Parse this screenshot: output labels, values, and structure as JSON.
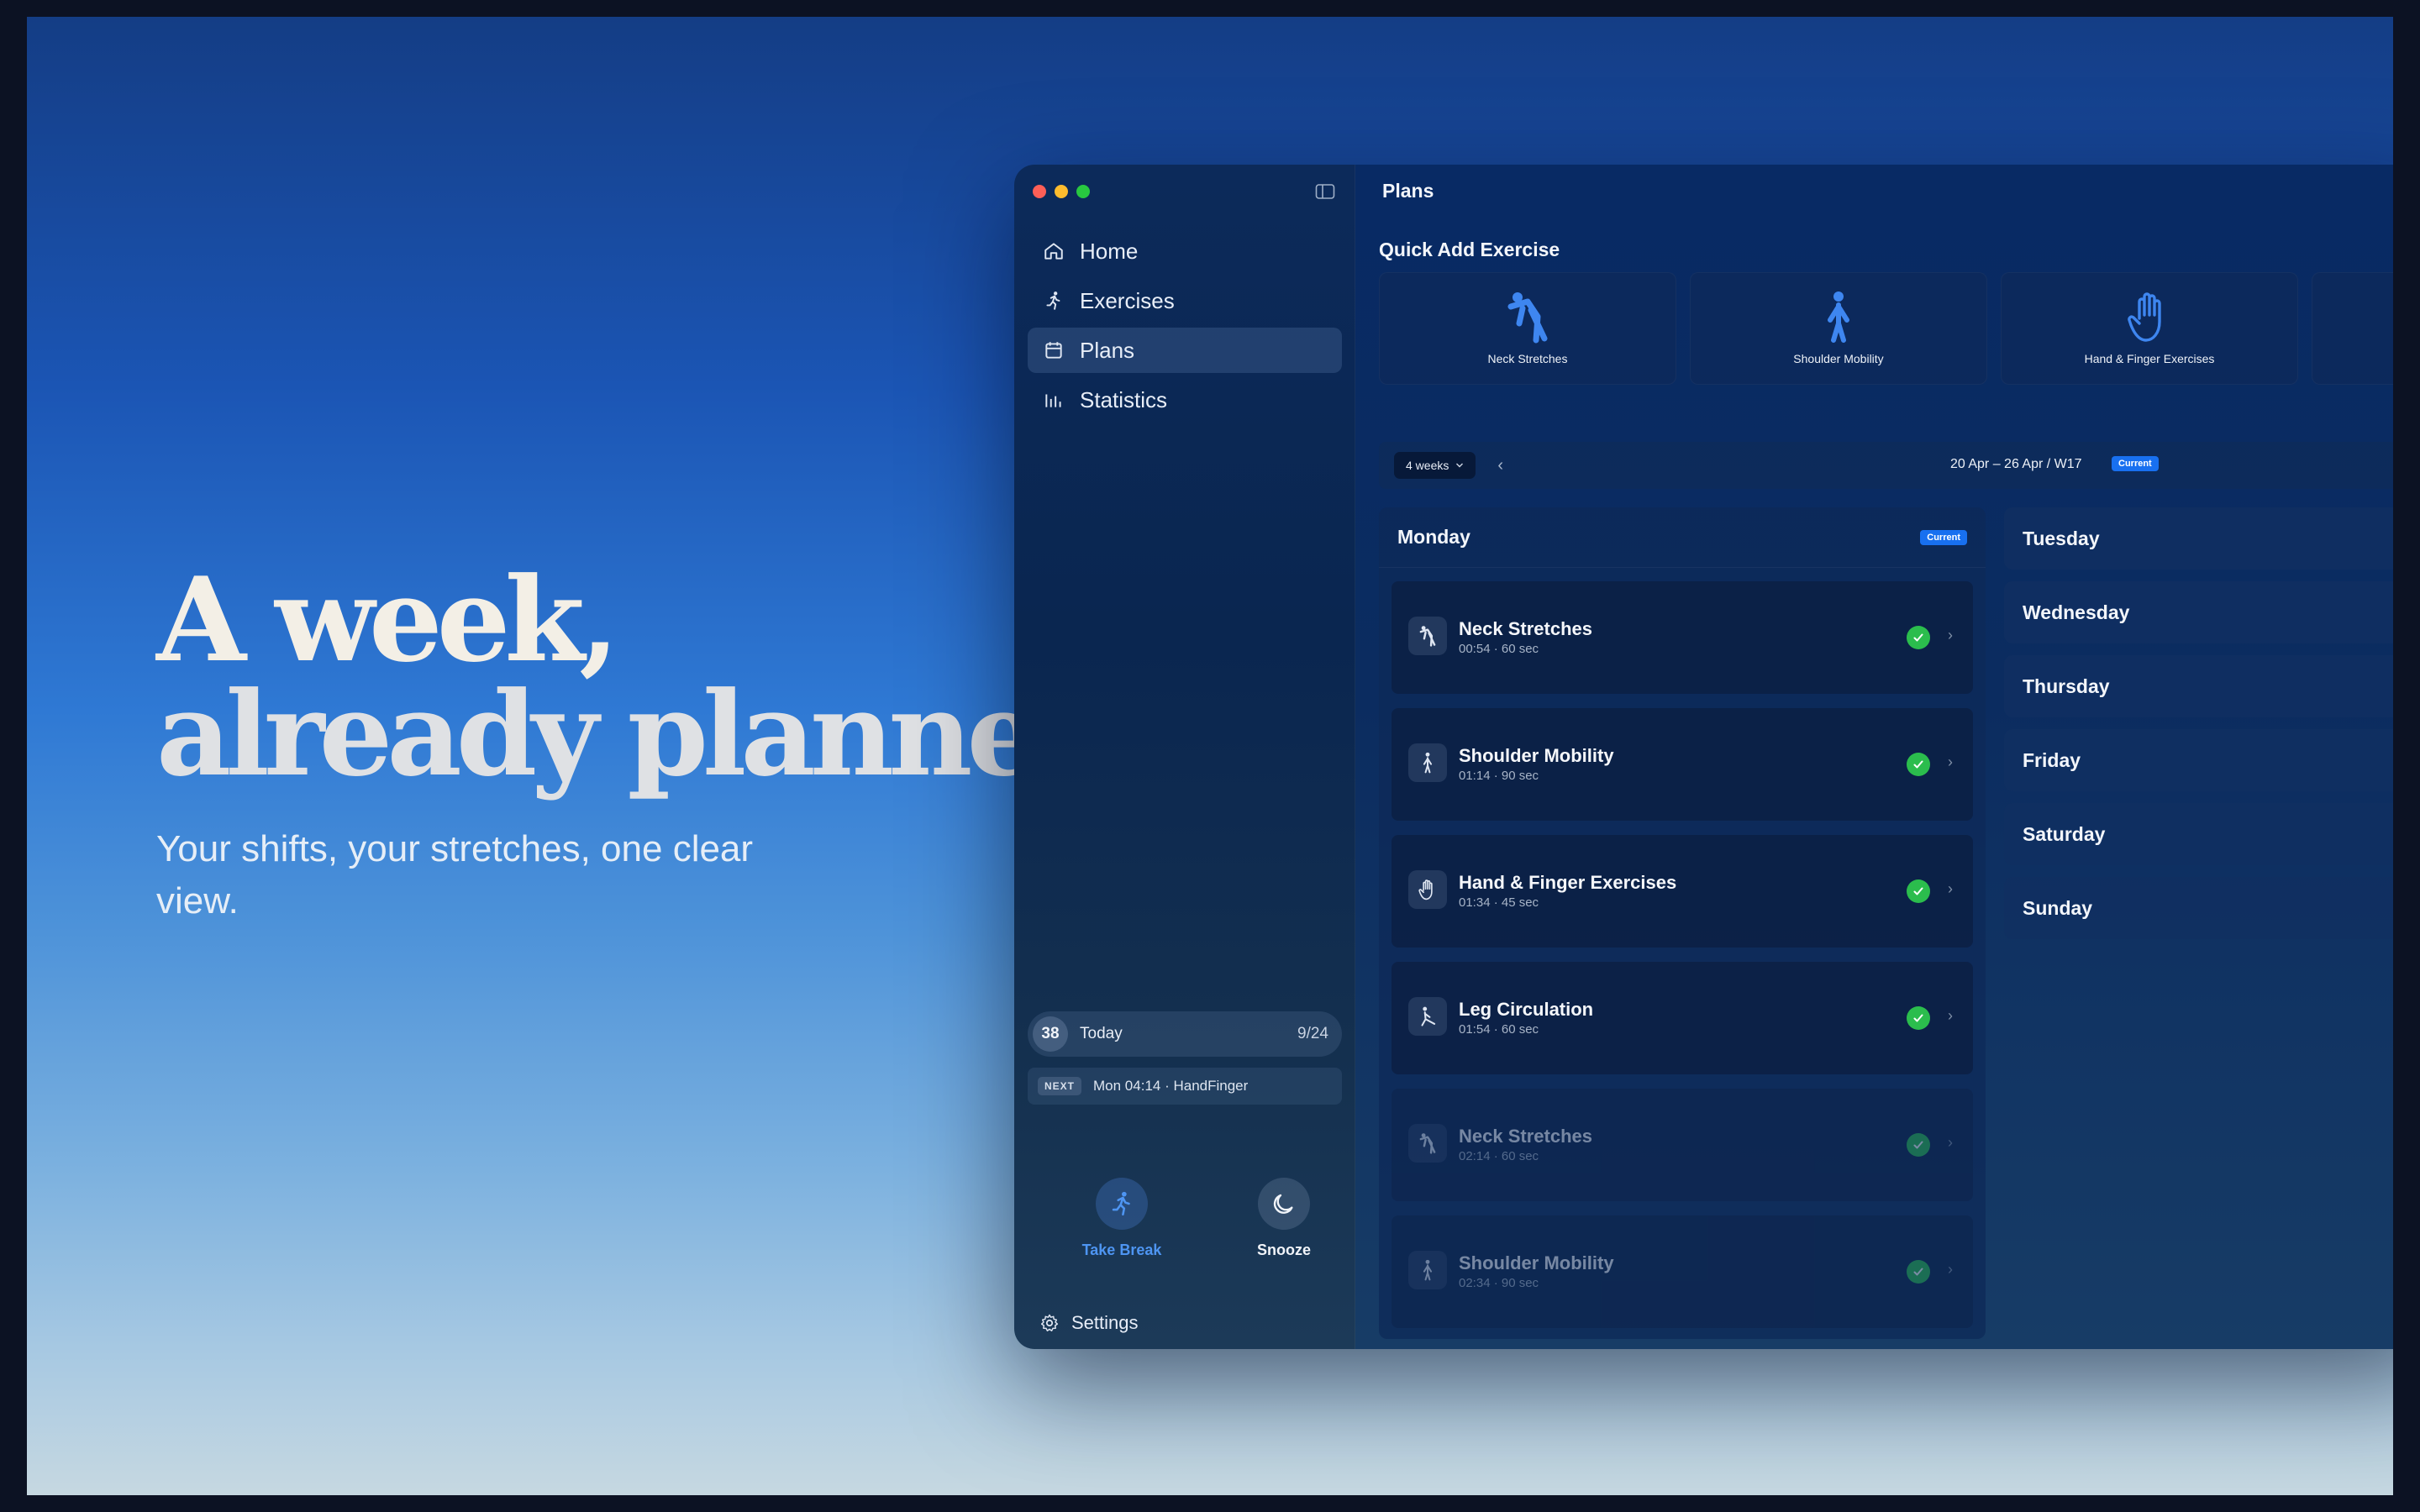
{
  "hero": {
    "title_line1": "A week,",
    "title_line2": "already planned.",
    "subtitle": "Your shifts, your stretches, one clear view."
  },
  "sidebar": {
    "nav": [
      {
        "label": "Home",
        "icon": "home-icon",
        "active": false
      },
      {
        "label": "Exercises",
        "icon": "running-icon",
        "active": false
      },
      {
        "label": "Plans",
        "icon": "calendar-icon",
        "active": true
      },
      {
        "label": "Statistics",
        "icon": "chart-icon",
        "active": false
      }
    ],
    "today": {
      "count": "38",
      "label": "Today",
      "ratio": "9/24"
    },
    "next": {
      "badge": "NEXT",
      "text": "Mon 04:14 · HandFinger"
    },
    "actions": {
      "take_break": "Take Break",
      "snooze": "Snooze"
    },
    "settings": "Settings"
  },
  "main": {
    "title": "Plans",
    "quick_add": {
      "title": "Quick Add Exercise",
      "items": [
        {
          "label": "Neck Stretches",
          "icon": "neck-stretch-icon"
        },
        {
          "label": "Shoulder Mobility",
          "icon": "standing-person-icon"
        },
        {
          "label": "Hand & Finger Exercises",
          "icon": "hand-icon"
        }
      ]
    },
    "toolbar": {
      "range_select": "4 weeks",
      "week_range": "20 Apr – 26 Apr / W17",
      "current_badge": "Current"
    },
    "monday": {
      "name": "Monday",
      "badge": "Current",
      "exercises": [
        {
          "name": "Neck Stretches",
          "meta": "00:54 · 60 sec",
          "done": true,
          "icon": "neck-stretch-icon",
          "faded": false
        },
        {
          "name": "Shoulder Mobility",
          "meta": "01:14 · 90 sec",
          "done": true,
          "icon": "standing-person-icon",
          "faded": false
        },
        {
          "name": "Hand & Finger Exercises",
          "meta": "01:34 · 45 sec",
          "done": true,
          "icon": "hand-icon",
          "faded": false
        },
        {
          "name": "Leg Circulation",
          "meta": "01:54 · 60 sec",
          "done": true,
          "icon": "leg-stretch-icon",
          "faded": false
        },
        {
          "name": "Neck Stretches",
          "meta": "02:14 · 60 sec",
          "done": true,
          "icon": "neck-stretch-icon",
          "faded": true
        },
        {
          "name": "Shoulder Mobility",
          "meta": "02:34 · 90 sec",
          "done": true,
          "icon": "standing-person-icon",
          "faded": true
        }
      ]
    },
    "other_days": [
      "Tuesday",
      "Wednesday",
      "Thursday",
      "Friday",
      "Saturday",
      "Sunday"
    ]
  },
  "colors": {
    "accent": "#1870f0",
    "check": "#2bbd4d",
    "take_break": "#4e95f2"
  }
}
